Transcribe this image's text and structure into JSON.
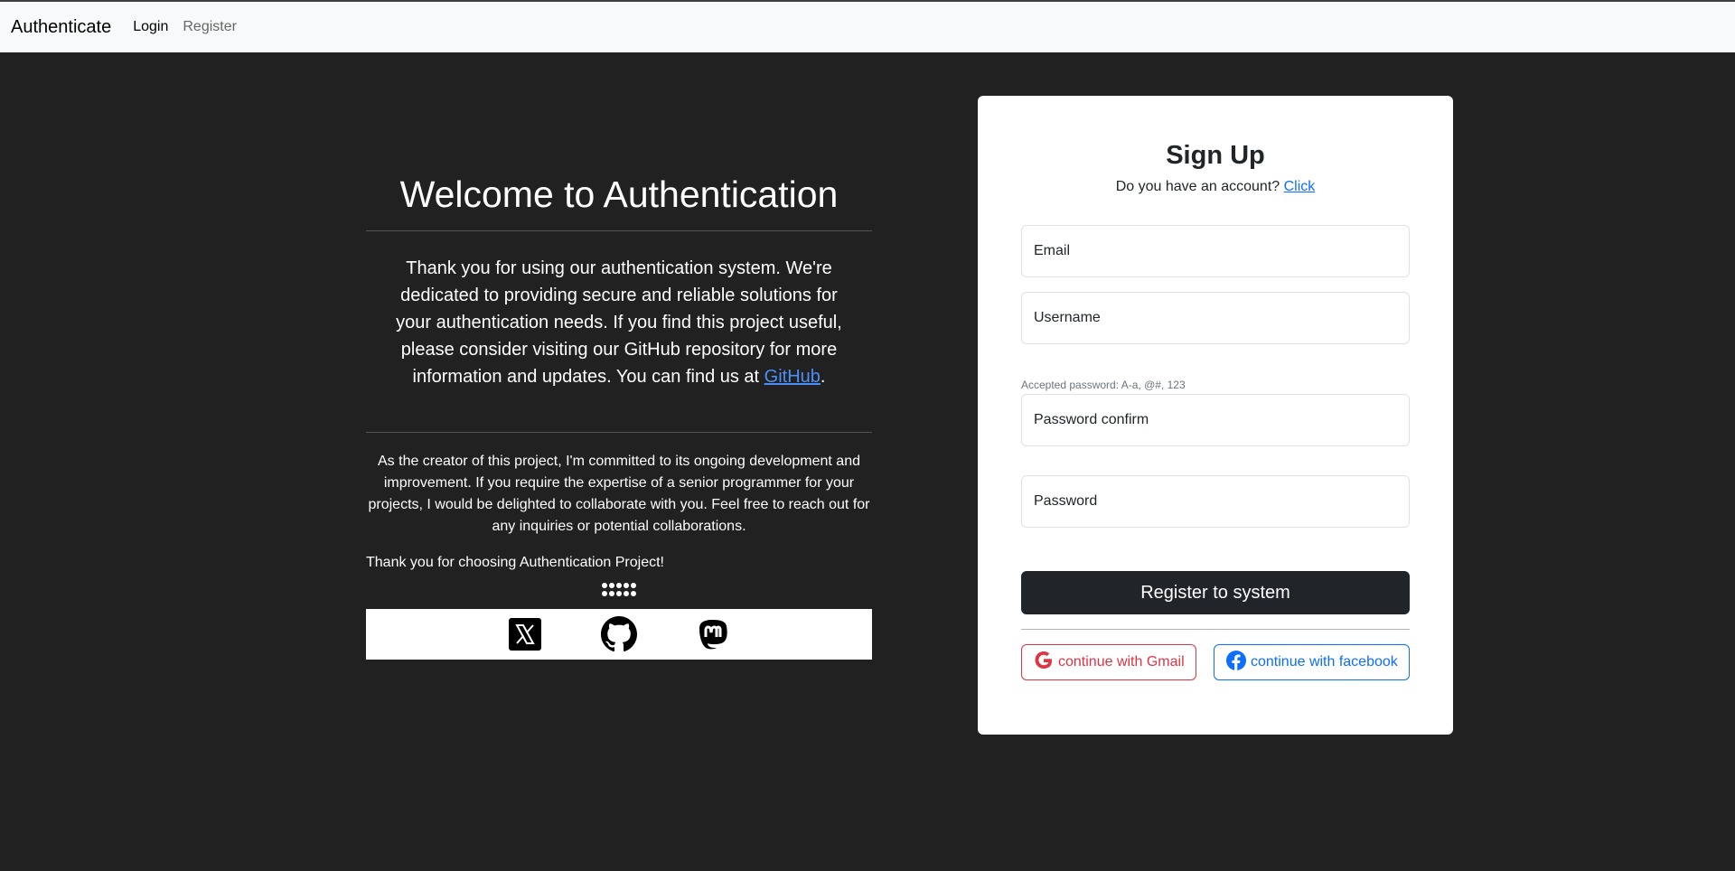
{
  "nav": {
    "brand": "Authenticate",
    "login": "Login",
    "register": "Register"
  },
  "left": {
    "welcome": "Welcome to Authentication",
    "intro_text": "Thank you for using our authentication system. We're dedicated to providing secure and reliable solutions for your authentication needs. If you find this project useful, please consider visiting our GitHub repository for more information and updates. You can find us at ",
    "github_link": "GitHub",
    "intro_end": ".",
    "creator": "As the creator of this project, I'm committed to its ongoing development and improvement. If you require the expertise of a senior programmer for your projects, I would be delighted to collaborate with you. Feel free to reach out for any inquiries or potential collaborations.",
    "thanks": "Thank you for choosing Authentication Project!",
    "social_icons": [
      "x-icon",
      "github-icon",
      "mastodon-icon"
    ]
  },
  "card": {
    "title": "Sign Up",
    "account_question": "Do you have an account? ",
    "account_link": "Click",
    "email_placeholder": "Email",
    "username_placeholder": "Username",
    "password_hint": "Accepted password: A-a, @#, 123",
    "password_confirm_placeholder": "Password confirm",
    "password_placeholder": "Password",
    "register_label": "Register to system",
    "gmail_label": "continue with Gmail",
    "facebook_label": "continue with facebook"
  },
  "colors": {
    "background": "#212121",
    "navbar": "#f8f9fa",
    "link": "#0d6efd",
    "gmail": "#dc3545",
    "facebook": "#0d6efd",
    "button_dark": "#212529"
  }
}
